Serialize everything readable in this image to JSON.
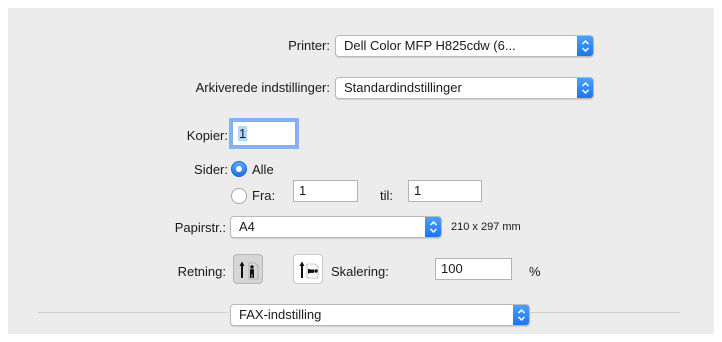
{
  "printer": {
    "label": "Printer:",
    "value": "Dell Color MFP H825cdw (6..."
  },
  "presets": {
    "label": "Arkiverede indstillinger:",
    "value": "Standardindstillinger"
  },
  "copies": {
    "label": "Kopier:",
    "value": "1"
  },
  "pages": {
    "label": "Sider:",
    "all_label": "Alle",
    "all_selected": true,
    "from_label": "Fra:",
    "from_value": "1",
    "to_label": "til:",
    "to_value": "1"
  },
  "paper_size": {
    "label": "Papirstr.:",
    "value": "A4",
    "dimensions": "210 x 297 mm"
  },
  "orientation": {
    "label": "Retning:",
    "selected": "portrait"
  },
  "scaling": {
    "label": "Skalering:",
    "value": "100",
    "unit": "%"
  },
  "section": {
    "value": "FAX-indstilling"
  },
  "colors": {
    "panel_bg": "#ececec",
    "accent": "#1a73f0",
    "focus_ring": "#84b2f4"
  }
}
